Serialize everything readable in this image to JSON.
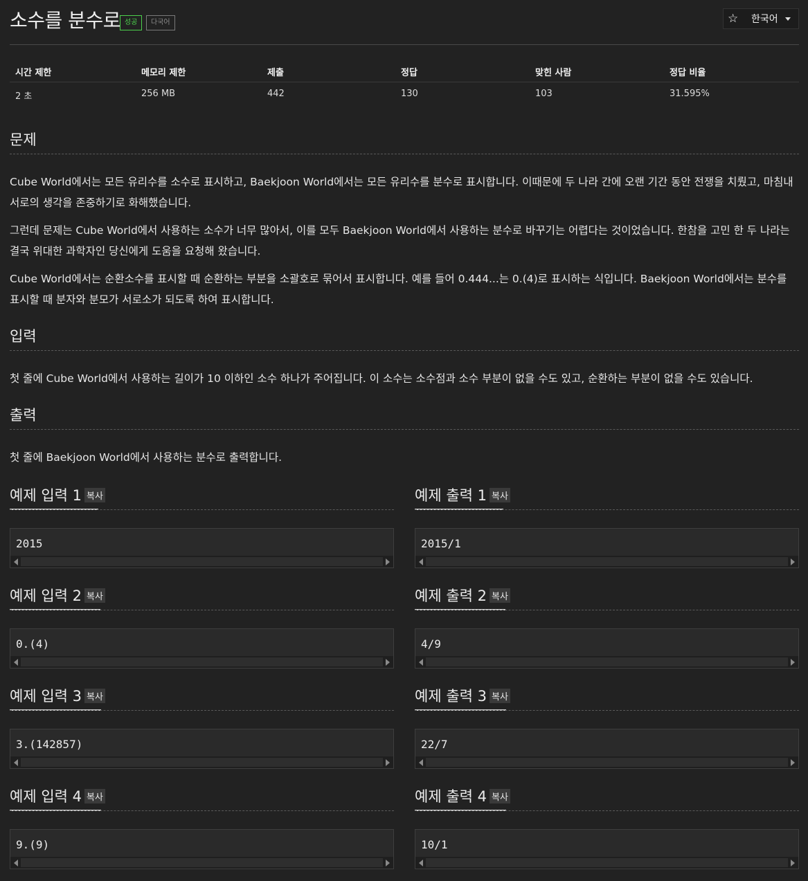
{
  "problem": {
    "title": "소수를 분수로",
    "badge_status": "성공",
    "badge_multilang": "다국어",
    "language": "한국어"
  },
  "info": {
    "headers": [
      "시간 제한",
      "메모리 제한",
      "제출",
      "정답",
      "맞힌 사람",
      "정답 비율"
    ],
    "values": [
      "2 초",
      "256 MB",
      "442",
      "130",
      "103",
      "31.595%"
    ]
  },
  "sections": {
    "problem_title": "문제",
    "problem_paragraphs": [
      "Cube World에서는 모든 유리수를 소수로 표시하고, Baekjoon World에서는 모든 유리수를 분수로 표시합니다. 이때문에 두 나라 간에 오랜 기간 동안 전쟁을 치뤘고, 마침내 서로의 생각을 존중하기로 화해했습니다.",
      "그런데 문제는 Cube World에서 사용하는 소수가 너무 많아서, 이를 모두 Baekjoon World에서 사용하는 분수로 바꾸기는 어렵다는 것이었습니다. 한참을 고민 한 두 나라는 결국 위대한 과학자인 당신에게 도움을 요청해 왔습니다.",
      "Cube World에서는 순환소수를 표시할 때 순환하는 부분을 소괄호로 묶어서 표시합니다. 예를 들어 0.444...는 0.(4)로 표시하는 식입니다. Baekjoon World에서는 분수를 표시할 때 분자와 분모가 서로소가 되도록 하여 표시합니다."
    ],
    "input_title": "입력",
    "input_text": "첫 줄에 Cube World에서 사용하는 길이가 10 이하인 소수 하나가 주어집니다. 이 소수는 소수점과 소수 부분이 없을 수도 있고, 순환하는 부분이 없을 수도 있습니다.",
    "output_title": "출력",
    "output_text": "첫 줄에 Baekjoon World에서 사용하는 분수로 출력합니다."
  },
  "samples": {
    "copy_label": "복사",
    "inputs": [
      {
        "title": "예제 입력 1",
        "value": "2015"
      },
      {
        "title": "예제 입력 2",
        "value": "0.(4)"
      },
      {
        "title": "예제 입력 3",
        "value": "3.(142857)"
      },
      {
        "title": "예제 입력 4",
        "value": "9.(9)"
      }
    ],
    "outputs": [
      {
        "title": "예제 출력 1",
        "value": "2015/1"
      },
      {
        "title": "예제 출력 2",
        "value": "4/9"
      },
      {
        "title": "예제 출력 3",
        "value": "22/7"
      },
      {
        "title": "예제 출력 4",
        "value": "10/1"
      }
    ]
  },
  "colors": {
    "background": "#222222",
    "success": "#4cd14c",
    "text": "#e6e6e6"
  }
}
